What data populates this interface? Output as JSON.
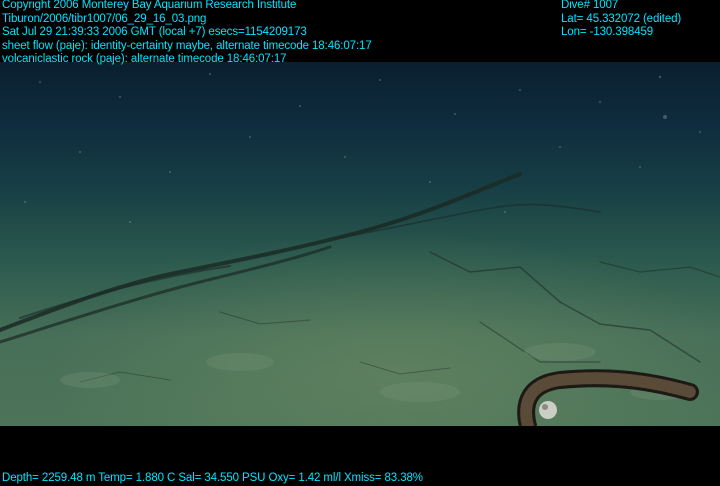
{
  "overlay": {
    "left_lines": [
      "Copyright 2006 Monterey Bay Aquarium Research Institute",
      "Tiburon/2006/tibr1007/06_29_16_03.png",
      "Sat Jul 29 21:39:33 2006 GMT (local +7)  esecs=1154209173",
      "sheet flow (paje): identity-certainty maybe, alternate timecode 18:46:07:17",
      "volcaniclastic rock (paje): alternate timecode 18:46:07:17"
    ],
    "right_lines": [
      "Dive# 1007",
      "Lat= 45.332072 (edited)",
      "Lon= -130.398459"
    ],
    "bottom_line": "Depth= 2259.48 m  Temp= 1.880 C  Sal= 34.550 PSU  Oxy= 1.42 ml/l  Xmiss= 83.38%"
  },
  "colors": {
    "overlay_text": "#00e5ff",
    "water_dark": "#0a1f30",
    "seafloor": "#4d7459"
  }
}
